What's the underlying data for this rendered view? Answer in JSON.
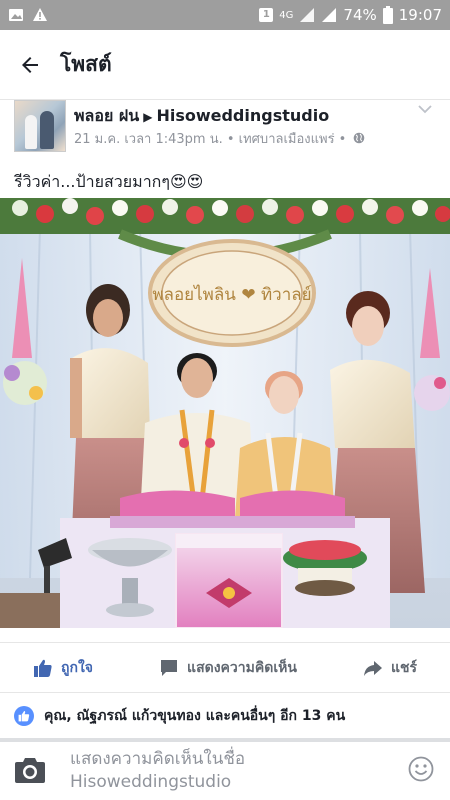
{
  "status_bar": {
    "signal_label": "4G",
    "battery": "74%",
    "time": "19:07",
    "sim_badge": "1",
    "colors": {
      "background": "#9e9e9e"
    }
  },
  "app_bar": {
    "title": "โพสต์",
    "back_icon": "arrow-left-icon"
  },
  "post": {
    "author": "พลอย ฝน",
    "target_page": "Hisoweddingstudio",
    "meta": "21 ม.ค. เวลา 1:43pm น. • เทศบาลเมืองแพร่ •",
    "privacy_icon": "globe-icon",
    "text": "รีวิวค่า...ป้ายสวยมากๆ😍😍",
    "sign_text": "พลอยไพลิน ❤ ทิวาลย์"
  },
  "actions": {
    "like": "ถูกใจ",
    "comment": "แสดงความคิดเห็น",
    "share": "แชร์"
  },
  "likes": {
    "text": "คุณ, ณัฐภรณ์ แก้วขุนทอง และคนอื่นๆ อีก 13 คน"
  },
  "comment_box": {
    "placeholder": "แสดงความคิดเห็นในชื่อ Hisoweddingstudio"
  },
  "colors": {
    "accent": "#4267b2",
    "like_badge": "#5890ff",
    "text_muted": "#90949c"
  }
}
